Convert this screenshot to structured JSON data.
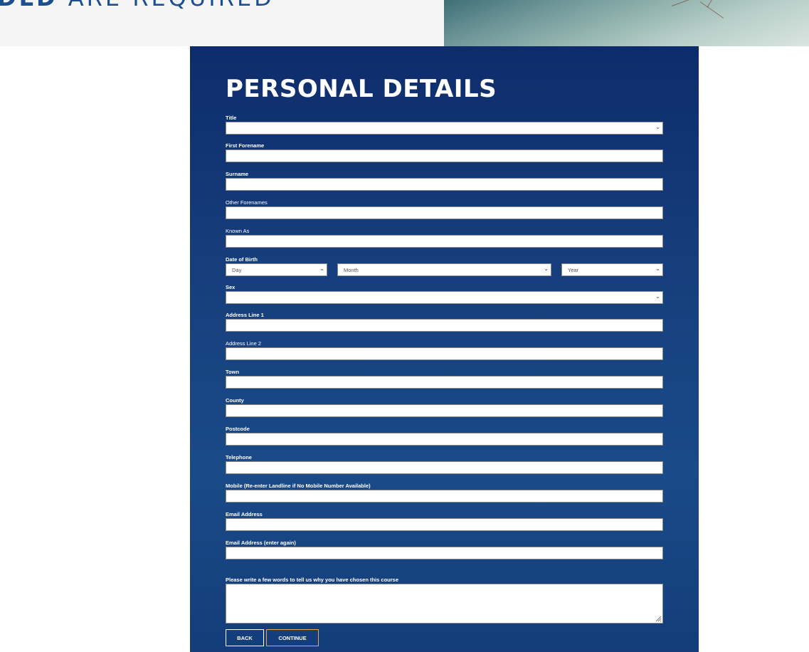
{
  "header": {
    "heading_bold": "DLD",
    "heading_rest": "ARE REQUIRED"
  },
  "form": {
    "title": "PERSONAL DETAILS",
    "labels": {
      "title": "Title",
      "first_forename": "First Forename",
      "surname": "Surname",
      "other_forenames": "Other Forenames",
      "known_as": "Known As",
      "dob": "Date of Birth",
      "sex": "Sex",
      "address1": "Address Line 1",
      "address2": "Address Line 2",
      "town": "Town",
      "county": "County",
      "postcode": "Postcode",
      "telephone": "Telephone",
      "mobile": "Mobile (Re-enter Landline if No Mobile Number Available)",
      "email": "Email Address",
      "email_again": "Email Address (enter again)",
      "reason": "Please write a few words to tell us why you have chosen this course"
    },
    "dob": {
      "day": "Day",
      "month": "Month",
      "year": "Year"
    },
    "values": {
      "title": "",
      "first_forename": "",
      "surname": "",
      "other_forenames": "",
      "known_as": "",
      "sex": "",
      "address1": "",
      "address2": "",
      "town": "",
      "county": "",
      "postcode": "",
      "telephone": "",
      "mobile": "",
      "email": "",
      "email_again": "",
      "reason": ""
    },
    "buttons": {
      "back": "BACK",
      "continue": "CONTINUE"
    }
  },
  "colors": {
    "panel": "#163d7c",
    "heading": "#1b4f8f",
    "continue_border": "#f0a155"
  }
}
